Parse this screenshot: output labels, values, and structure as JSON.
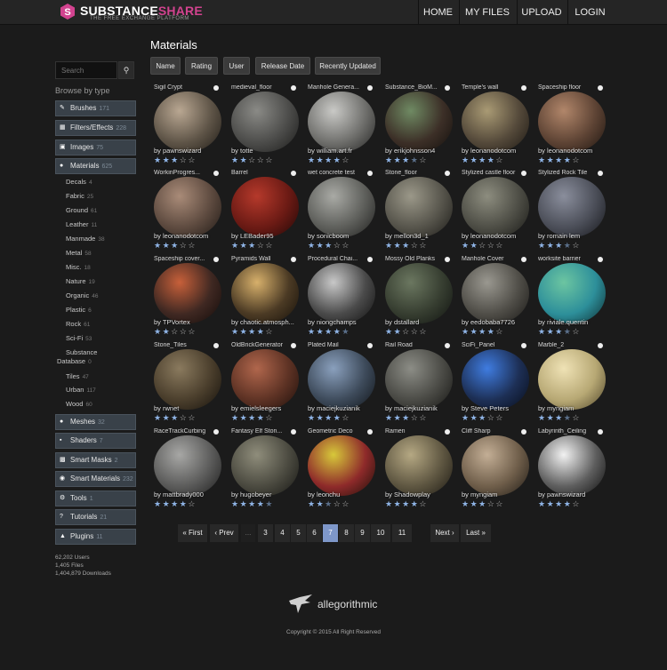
{
  "header": {
    "brand_main": "SUBSTANCE",
    "brand_accent": "SHARE",
    "tagline": "THE FREE EXCHANGE PLATFORM",
    "nav": [
      "HOME",
      "MY FILES",
      "UPLOAD",
      "LOGIN"
    ]
  },
  "page_title": "Materials",
  "sort_buttons": [
    "Name",
    "Rating",
    "User",
    "Release Date",
    "Recently Updated"
  ],
  "search": {
    "placeholder": "Search"
  },
  "sidebar": {
    "browse_label": "Browse by type",
    "categories_top": [
      {
        "label": "Brushes",
        "count": "171",
        "icon": "brush-icon"
      },
      {
        "label": "Filters/Effects",
        "count": "228",
        "icon": "filter-icon"
      },
      {
        "label": "Images",
        "count": "75",
        "icon": "image-icon"
      },
      {
        "label": "Materials",
        "count": "625",
        "icon": "sphere-icon"
      }
    ],
    "subcategories": [
      {
        "label": "Decals",
        "count": "4"
      },
      {
        "label": "Fabric",
        "count": "25"
      },
      {
        "label": "Ground",
        "count": "61"
      },
      {
        "label": "Leather",
        "count": "11"
      },
      {
        "label": "Manmade",
        "count": "38"
      },
      {
        "label": "Metal",
        "count": "58"
      },
      {
        "label": "Misc.",
        "count": "18"
      },
      {
        "label": "Nature",
        "count": "19"
      },
      {
        "label": "Organic",
        "count": "46"
      },
      {
        "label": "Plastic",
        "count": "6"
      },
      {
        "label": "Rock",
        "count": "61"
      },
      {
        "label": "Sci-Fi",
        "count": "53"
      },
      {
        "label": "Substance",
        "label2": "Database",
        "count": "0"
      },
      {
        "label": "Tiles",
        "count": "47"
      },
      {
        "label": "Urban",
        "count": "117"
      },
      {
        "label": "Wood",
        "count": "60"
      }
    ],
    "categories_bottom": [
      {
        "label": "Meshes",
        "count": "32",
        "icon": "mesh-icon"
      },
      {
        "label": "Shaders",
        "count": "7",
        "icon": "shader-icon"
      },
      {
        "label": "Smart Masks",
        "count": "2",
        "icon": "mask-icon"
      },
      {
        "label": "Smart Materials",
        "count": "232",
        "icon": "smart-material-icon"
      },
      {
        "label": "Tools",
        "count": "1",
        "icon": "gear-icon"
      },
      {
        "label": "Tutorials",
        "count": "21",
        "icon": "help-icon"
      },
      {
        "label": "Plugins",
        "count": "11",
        "icon": "plugin-icon"
      }
    ],
    "stats": [
      "62,202 Users",
      "1,405 Files",
      "1,404,879 Downloads"
    ]
  },
  "materials": [
    {
      "title": "Sigil Crypt",
      "author": "by pawnswizard",
      "rating": 3,
      "colors": [
        "#b9a792",
        "#5e5447",
        "#1f1b16"
      ]
    },
    {
      "title": "medieval_floor",
      "author": "by totte",
      "rating": 2,
      "colors": [
        "#8a8a86",
        "#4c4c4a",
        "#1a1a19"
      ]
    },
    {
      "title": "Manhole Genera...",
      "author": "by william.art.fr",
      "rating": 4,
      "colors": [
        "#c9c9c6",
        "#6f6f6c",
        "#222221"
      ]
    },
    {
      "title": "Substance_BioM...",
      "author": "by erikjohnsson4",
      "rating": 3.5,
      "colors": [
        "#6f8a63",
        "#3c2f27",
        "#120f0c"
      ]
    },
    {
      "title": "Temple's wall",
      "author": "by leonanodotcom",
      "rating": 4,
      "colors": [
        "#a99a74",
        "#54493a",
        "#1b1712"
      ]
    },
    {
      "title": "Spaceship floor",
      "author": "by leonanodotcom",
      "rating": 4,
      "colors": [
        "#b1866a",
        "#5d4334",
        "#1c140f"
      ]
    },
    {
      "title": "WorkinProgres...",
      "author": "by leonanodotcom",
      "rating": 3,
      "colors": [
        "#a98b78",
        "#5d4a3f",
        "#1f1915"
      ]
    },
    {
      "title": "Barrel",
      "author": "by LEBader95",
      "rating": 3,
      "colors": [
        "#b5392b",
        "#6a1a14",
        "#1f0807"
      ]
    },
    {
      "title": "wet concrete test",
      "author": "by sonicboom",
      "rating": 3,
      "colors": [
        "#a9aaa5",
        "#5d5e5a",
        "#1e1e1d"
      ]
    },
    {
      "title": "Stone_floor",
      "author": "by mellon3d_1",
      "rating": 3,
      "colors": [
        "#9b9889",
        "#56544b",
        "#1b1a17"
      ]
    },
    {
      "title": "Stylized castle floor",
      "author": "by leonanodotcom",
      "rating": 2,
      "colors": [
        "#8d8d7f",
        "#4d4d45",
        "#181815"
      ]
    },
    {
      "title": "Stylized Rock Tile",
      "author": "by romain lem",
      "rating": 3.5,
      "colors": [
        "#8a8e9c",
        "#4b4e58",
        "#15161a"
      ]
    },
    {
      "title": "Spaceship cover...",
      "author": "by TPVortex",
      "rating": 2,
      "colors": [
        "#c7603a",
        "#3f2822",
        "#120b09"
      ]
    },
    {
      "title": "Pyramids Wall",
      "author": "by chaotic.atmosph...",
      "rating": 4,
      "colors": [
        "#d7b06b",
        "#4b3a24",
        "#140f09"
      ]
    },
    {
      "title": "Procedural Chai...",
      "author": "by niongchamps",
      "rating": 4.5,
      "colors": [
        "#c8c8c8",
        "#4a4a4a",
        "#0f0f0f"
      ]
    },
    {
      "title": "Mossy Old Planks",
      "author": "by dstallard",
      "rating": 2,
      "colors": [
        "#6b7760",
        "#363d30",
        "#101310"
      ]
    },
    {
      "title": "Manhole Cover",
      "author": "by eedobaba7726",
      "rating": 4,
      "colors": [
        "#9a9890",
        "#4f4d47",
        "#181715"
      ]
    },
    {
      "title": "worksite barrier",
      "author": "by riviale.quentin",
      "rating": 3.5,
      "colors": [
        "#6cc5a1",
        "#2d8f9a",
        "#0e2b2f"
      ]
    },
    {
      "title": "Stone_Tiles",
      "author": "by rwnet",
      "rating": 3,
      "colors": [
        "#8a7a5e",
        "#4a3e2c",
        "#14100b"
      ]
    },
    {
      "title": "OldBrickGenerator",
      "author": "by emielsleegers",
      "rating": 4,
      "colors": [
        "#b0664c",
        "#5d3224",
        "#1c0f0b"
      ]
    },
    {
      "title": "Plated Mail",
      "author": "by maciejkuzianik",
      "rating": 4,
      "colors": [
        "#8aa0bd",
        "#3d4a5a",
        "#101418"
      ]
    },
    {
      "title": "Rail Road",
      "author": "by maciejkuzianik",
      "rating": 3,
      "colors": [
        "#8c8d86",
        "#4a4a45",
        "#151513"
      ]
    },
    {
      "title": "SciFi_Panel",
      "author": "by Steve Peters",
      "rating": 3,
      "colors": [
        "#3f7ce0",
        "#1d2f55",
        "#070c17"
      ]
    },
    {
      "title": "Marble_2",
      "author": "by myngiam",
      "rating": 3.5,
      "colors": [
        "#efe2b5",
        "#b7a874",
        "#4d4328"
      ]
    },
    {
      "title": "RaceTrackCurbing",
      "author": "by mattbrady000",
      "rating": 4,
      "colors": [
        "#a7a7a5",
        "#5b5b5a",
        "#1c1c1c"
      ]
    },
    {
      "title": "Fantasy Elf Ston...",
      "author": "by hugobeyer",
      "rating": 4.5,
      "colors": [
        "#8f8d7b",
        "#4b4a40",
        "#161613"
      ]
    },
    {
      "title": "Geometric Deco",
      "author": "by leonchu",
      "rating": 2.5,
      "colors": [
        "#d7c83a",
        "#8e2a2a",
        "#1a0f08"
      ]
    },
    {
      "title": "Ramen",
      "author": "by Shadowplay",
      "rating": 4,
      "colors": [
        "#b5a883",
        "#5e5641",
        "#1b1812"
      ]
    },
    {
      "title": "Cliff Sharp",
      "author": "by myngiam",
      "rating": 3,
      "colors": [
        "#c3ae95",
        "#6f5e4a",
        "#1f1a15"
      ]
    },
    {
      "title": "Labyrinth_Ceiling",
      "author": "by pawnswizard",
      "rating": 4,
      "colors": [
        "#f2f2f2",
        "#5e5e5e",
        "#0d0d0d"
      ]
    }
  ],
  "pagination": {
    "first": "« First",
    "prev": "‹ Prev",
    "ellipsis": "...",
    "pages": [
      "3",
      "4",
      "5",
      "6",
      "7",
      "8",
      "9",
      "10",
      "11"
    ],
    "current": "7",
    "next": "Next ›",
    "last": "Last »"
  },
  "footer": {
    "brand": "allegorithmic",
    "copyright": "Copyright © 2015 All Right Reserved"
  },
  "colors": {
    "brand_accent": "#d2438f",
    "active_page": "#7e97c9",
    "star": "#8fb4e6",
    "category_bg": "#394149"
  }
}
